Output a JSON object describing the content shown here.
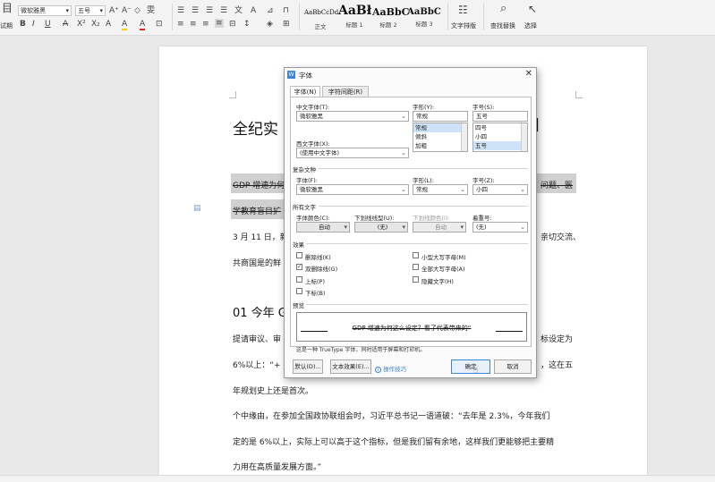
{
  "ribbon": {
    "left_label_a": "试期",
    "left_icon_label": "目",
    "font_name": "微软雅黑",
    "font_size": "五号",
    "row1_icons": [
      "A⁺",
      "A⁻",
      "◇",
      "雯",
      "☰",
      "☰",
      "☰",
      "☰",
      "☰",
      "文",
      "A",
      "⊿",
      "☰",
      "⊓"
    ],
    "row2_icons": [
      "B",
      "I",
      "U",
      "A",
      "X²",
      "X₂",
      "A",
      "A",
      "A",
      "⊡"
    ],
    "styles": [
      {
        "sample": "AaBbCcDd",
        "label": "正文"
      },
      {
        "sample": "AaBł",
        "label": "标题 1"
      },
      {
        "sample": "AaBbC",
        "label": "标题 2"
      },
      {
        "sample": "AaBbC",
        "label": "标题 3"
      }
    ],
    "text_layout": "文字排版",
    "find_replace": "查找替换",
    "select": "选择"
  },
  "document": {
    "title": "全纪实",
    "title_tail": "]",
    "p1_a": "GDP 增速为何",
    "p1_b": "问题、医",
    "p1_c": "学教育盲目扩",
    "p2_a": "3 月 11 日，新",
    "p2_b": "亲切交流、",
    "p2_c": "共商国是的鲜",
    "heading2": "01 今年 G",
    "p3_a": "提请审议、审",
    "p3_b": "标设定为",
    "p3_c": "6%以上：“+",
    "p3_d": "，这在五",
    "p4": "年规划史上还是首次。",
    "p5": "个中缘由，在参加全国政协联组会时，习近平总书记一语道破：“去年是 2.3%，今年我们",
    "p6": "定的是 6%以上，实际上可以高于这个指标，但是我们留有余地，这样我们更能够把主要精",
    "p7": "力用在高质量发展方面。”"
  },
  "dialog": {
    "title": "字体",
    "tabs": [
      "字体(N)",
      "字符间距(R)"
    ],
    "cn_font_label": "中文字体(T):",
    "cn_font_value": "微软雅黑",
    "style_label": "字形(Y):",
    "style_value": "常规",
    "style_options": [
      "常规",
      "倾斜",
      "加粗"
    ],
    "size_label": "字号(S):",
    "size_value": "五号",
    "size_options": [
      "四号",
      "小四",
      "五号"
    ],
    "west_font_label": "西文字体(X):",
    "west_font_value": "(使用中文字体)",
    "complex_group": "复杂文种",
    "complex_font_label": "字体(F):",
    "complex_font_value": "微软雅黑",
    "complex_style_label": "字形(L):",
    "complex_style_value": "常规",
    "complex_size_label": "字号(Z):",
    "complex_size_value": "小四",
    "all_text_group": "所有文字",
    "font_color_label": "字体颜色(C):",
    "font_color_value": "自动",
    "underline_label": "下划线线型(U):",
    "underline_value": "(无)",
    "underline_color_label": "下划线颜色(I):",
    "underline_color_value": "自动",
    "emphasis_label": "着重号:",
    "emphasis_value": "(无)",
    "effects_group": "效果",
    "effects_left": [
      {
        "label": "删除线(K)",
        "checked": false
      },
      {
        "label": "双删除线(G)",
        "checked": true
      },
      {
        "label": "上标(P)",
        "checked": false
      },
      {
        "label": "下标(B)",
        "checked": false
      }
    ],
    "effects_right": [
      {
        "label": "小型大写字母(M)",
        "checked": false
      },
      {
        "label": "全部大写字母(A)",
        "checked": false
      },
      {
        "label": "隐藏文字(H)",
        "checked": false
      }
    ],
    "preview_group": "预览",
    "preview_text": "GDP 增速为何这么设定？看了代表带来的“",
    "note": "这是一种 TrueType 字体，同时适用于屏幕和打印机。",
    "default_button": "默认(D)...",
    "text_effect_button": "文本效果(E)...",
    "tips_link": "操作技巧",
    "ok_button": "确定",
    "cancel_button": "取消"
  }
}
